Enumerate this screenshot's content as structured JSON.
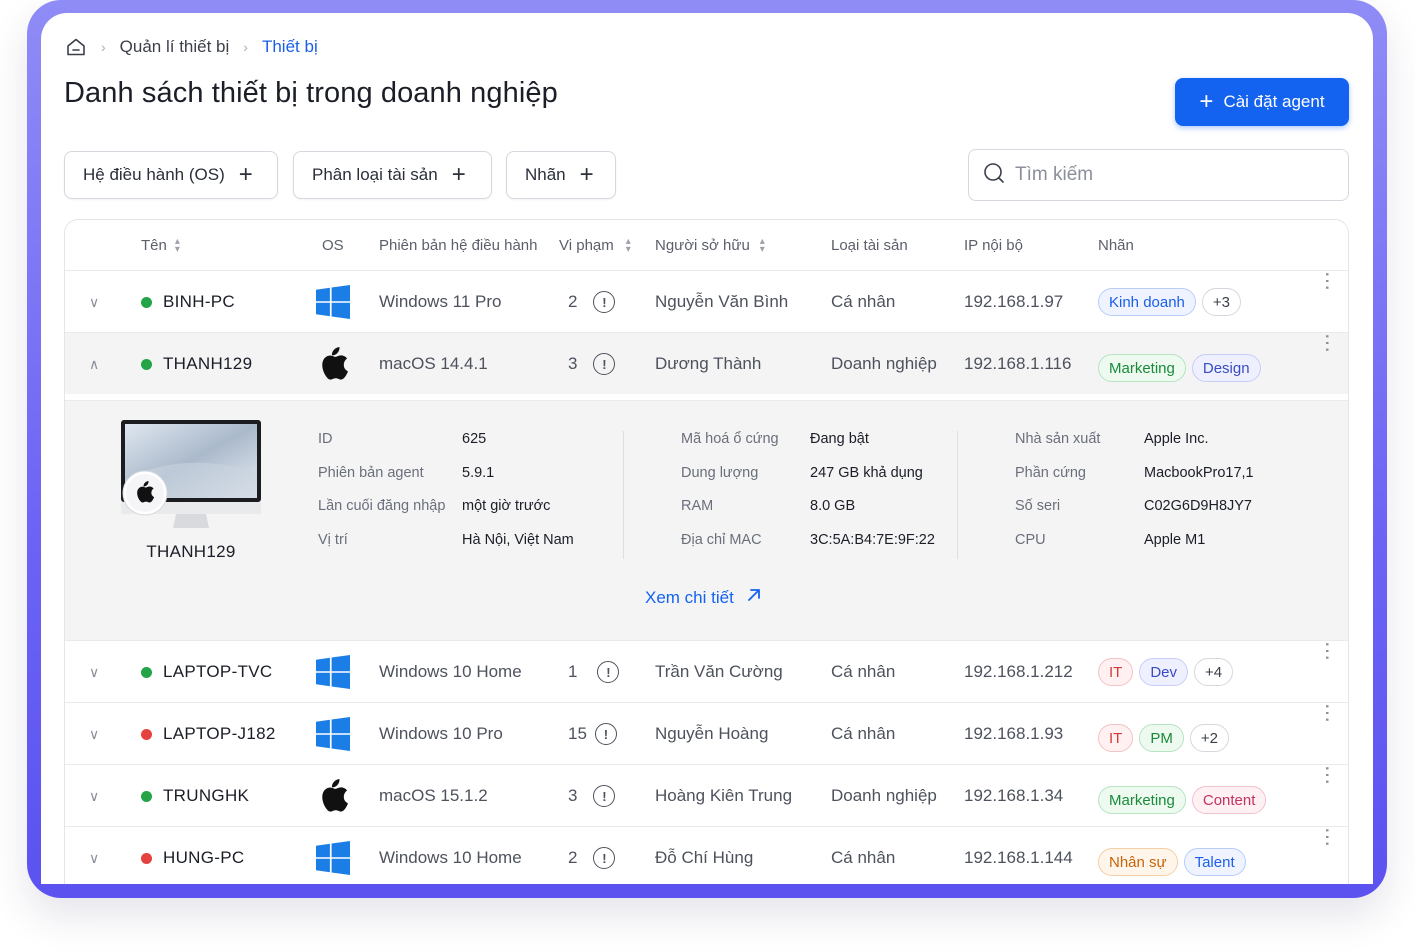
{
  "breadcrumb": {
    "items": [
      "Quản lí thiết bị",
      "Thiết bị"
    ]
  },
  "page": {
    "title": "Danh sách thiết bị trong doanh nghiệp",
    "install_button": "Cài đặt agent"
  },
  "filters": [
    {
      "label": "Hệ điều hành (OS)"
    },
    {
      "label": "Phân loại tài sản"
    },
    {
      "label": "Nhãn"
    }
  ],
  "search": {
    "placeholder": "Tìm kiếm"
  },
  "columns": {
    "name": "Tên",
    "os": "OS",
    "os_version": "Phiên bản hệ điều hành",
    "violations": "Vi phạm",
    "owner": "Người sở hữu",
    "asset_type": "Loại tài sản",
    "ip": "IP nội bộ",
    "tags": "Nhãn"
  },
  "colors": {
    "online": "#22a447",
    "offline": "#e5413e",
    "primary": "#1463f0"
  },
  "rows": [
    {
      "name": "BINH-PC",
      "status": "online",
      "os_icon": "windows-icon",
      "os_version": "Windows 11 Pro",
      "violations": "2",
      "owner": "Nguyễn Văn Bình",
      "asset_type": "Cá nhân",
      "ip": "192.168.1.97",
      "tags": [
        "Kinh doanh"
      ],
      "more": "+3",
      "expanded": false
    },
    {
      "name": "THANH129",
      "status": "online",
      "os_icon": "apple-icon",
      "os_version": "macOS 14.4.1",
      "violations": "3",
      "owner": "Dương Thành",
      "asset_type": "Doanh nghiệp",
      "ip": "192.168.1.116",
      "tags": [
        "Marketing",
        "Design"
      ],
      "more": "",
      "expanded": true
    },
    {
      "name": "LAPTOP-TVC",
      "status": "online",
      "os_icon": "windows-icon",
      "os_version": "Windows 10 Home",
      "violations": "1",
      "owner": "Trần Văn Cường",
      "asset_type": "Cá nhân",
      "ip": "192.168.1.212",
      "tags": [
        "IT",
        "Dev"
      ],
      "more": "+4",
      "expanded": false
    },
    {
      "name": "LAPTOP-J182",
      "status": "offline",
      "os_icon": "windows-icon",
      "os_version": "Windows 10 Pro",
      "violations": "15",
      "owner": "Nguyễn Hoàng",
      "asset_type": "Cá nhân",
      "ip": "192.168.1.93",
      "tags": [
        "IT",
        "PM"
      ],
      "more": "+2",
      "expanded": false
    },
    {
      "name": "TRUNGHK",
      "status": "online",
      "os_icon": "apple-icon",
      "os_version": "macOS 15.1.2",
      "violations": "3",
      "owner": "Hoàng Kiên Trung",
      "asset_type": "Doanh nghiệp",
      "ip": "192.168.1.34",
      "tags": [
        "Marketing",
        "Content"
      ],
      "more": "",
      "expanded": false
    },
    {
      "name": "HUNG-PC",
      "status": "offline",
      "os_icon": "windows-icon",
      "os_version": "Windows 10 Home",
      "violations": "2",
      "owner": "Đỗ Chí Hùng",
      "asset_type": "Cá nhân",
      "ip": "192.168.1.144",
      "tags": [
        "Nhân sự",
        "Talent"
      ],
      "more": "",
      "expanded": false
    }
  ],
  "detail": {
    "device_name": "THANH129",
    "col1": [
      {
        "label": "ID",
        "value": "625"
      },
      {
        "label": "Phiên bản agent",
        "value": "5.9.1"
      },
      {
        "label": "Lần cuối đăng nhập",
        "value": "một giờ trước"
      },
      {
        "label": "Vị trí",
        "value": "Hà Nội, Việt Nam"
      }
    ],
    "col2": [
      {
        "label": "Mã hoá ổ cứng",
        "value": "Đang bật"
      },
      {
        "label": "Dung lượng",
        "value": "247 GB khả dụng"
      },
      {
        "label": "RAM",
        "value": "8.0 GB"
      },
      {
        "label": "Địa chỉ MAC",
        "value": "3C:5A:B4:7E:9F:22"
      }
    ],
    "col3": [
      {
        "label": "Nhà sản xuất",
        "value": "Apple Inc."
      },
      {
        "label": "Phần cứng",
        "value": "MacbookPro17,1"
      },
      {
        "label": "Số seri",
        "value": "C02G6D9H8JY7"
      },
      {
        "label": "CPU",
        "value": "Apple M1"
      }
    ],
    "link": "Xem chi tiết"
  }
}
